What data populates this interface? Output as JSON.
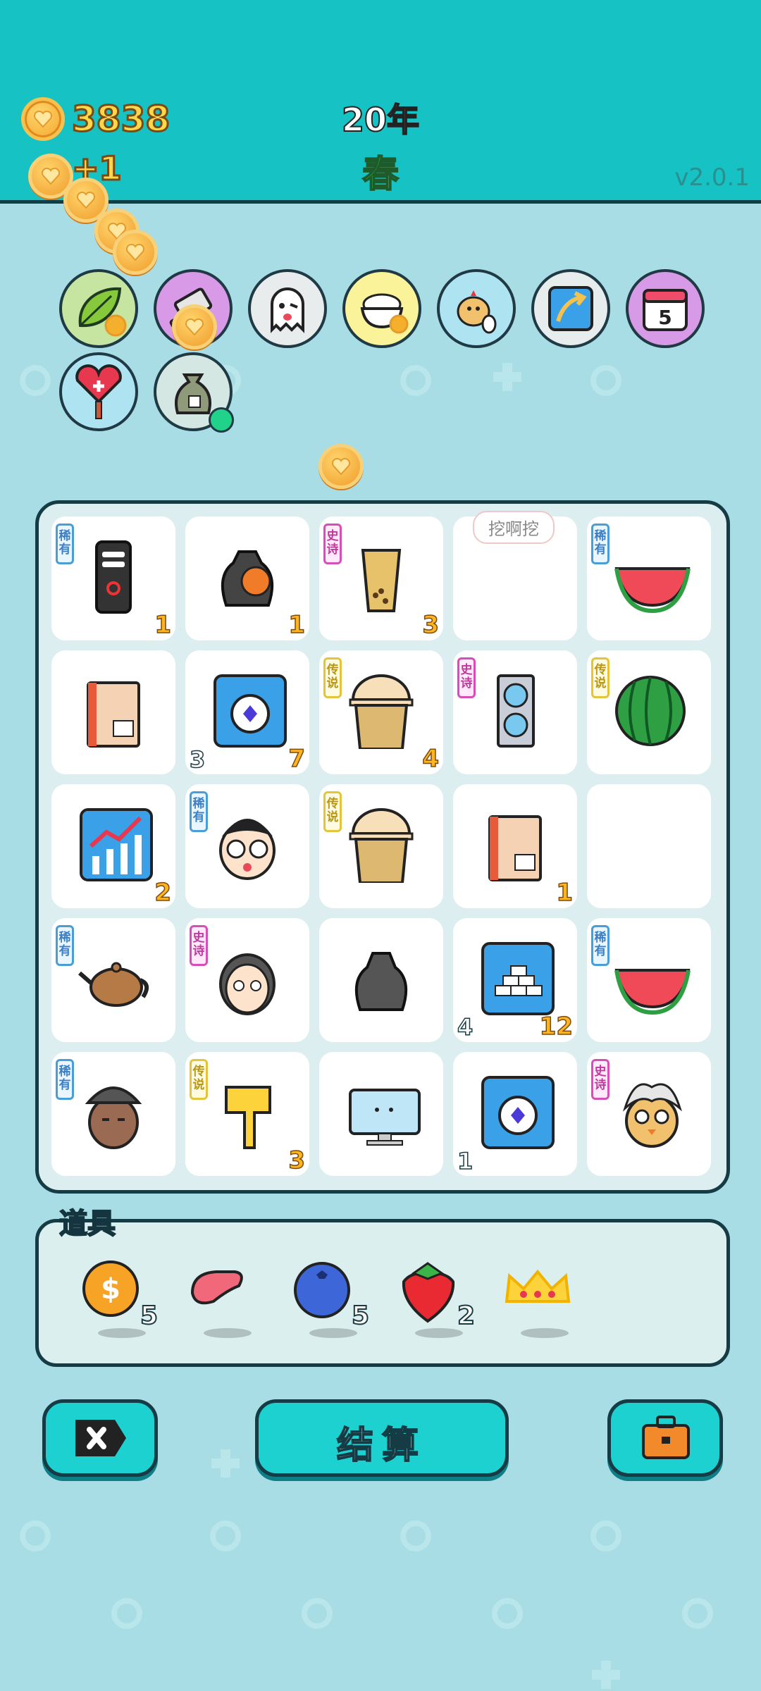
{
  "hud": {
    "coins": "3838",
    "coin_gain": "+1",
    "year": "20年",
    "season": "春",
    "version": "v2.0.1"
  },
  "relics": [
    {
      "name": "leaf-relic-icon",
      "bg": "#c6e5a0"
    },
    {
      "name": "cleaver-relic-icon",
      "bg": "#d899e6"
    },
    {
      "name": "ghost-relic-icon",
      "bg": "#e8ecec"
    },
    {
      "name": "rice-bowl-relic-icon",
      "bg": "#fbf39a"
    },
    {
      "name": "chick-relic-icon",
      "bg": "#aee3f2"
    },
    {
      "name": "blue-arrow-relic-icon",
      "bg": "#e7ecec"
    },
    {
      "name": "calendar-relic-icon",
      "bg": "#d79ae6"
    },
    {
      "name": "heart-potion-relic-icon",
      "bg": "#aee3f2"
    },
    {
      "name": "money-bag-relic-icon",
      "bg": "#d4e7e3"
    }
  ],
  "calendar_day": "5",
  "board": {
    "dig_bubble": "挖啊挖",
    "tags": {
      "rare": "稀有",
      "epic": "史诗",
      "legend": "传说"
    },
    "cells": [
      {
        "item": "phone-icon",
        "tag": "rare",
        "br": "1",
        "bl": ""
      },
      {
        "item": "trash-bag-basketball-icon",
        "tag": "",
        "br": "1",
        "bl": ""
      },
      {
        "item": "bubble-tea-icon",
        "tag": "epic",
        "br": "3",
        "bl": ""
      },
      {
        "item": "empty",
        "tag": "",
        "br": "",
        "bl": ""
      },
      {
        "item": "watermelon-slice-icon",
        "tag": "rare",
        "br": "",
        "bl": ""
      },
      {
        "item": "cardboard-box-icon",
        "tag": "",
        "br": "",
        "bl": ""
      },
      {
        "item": "stopwatch-card-icon",
        "tag": "",
        "br": "7",
        "bl": "3"
      },
      {
        "item": "milk-tea-cup-icon",
        "tag": "legend",
        "br": "4",
        "bl": ""
      },
      {
        "item": "graphics-card-icon",
        "tag": "epic",
        "br": "",
        "bl": ""
      },
      {
        "item": "whole-watermelon-icon",
        "tag": "legend",
        "br": "",
        "bl": ""
      },
      {
        "item": "growth-chart-icon",
        "tag": "",
        "br": "2",
        "bl": ""
      },
      {
        "item": "glasses-boy-face-icon",
        "tag": "rare",
        "br": "",
        "bl": ""
      },
      {
        "item": "milk-tea-cup-icon",
        "tag": "legend",
        "br": "",
        "bl": ""
      },
      {
        "item": "cardboard-box-icon",
        "tag": "",
        "br": "1",
        "bl": ""
      },
      {
        "item": "empty",
        "tag": "",
        "br": "",
        "bl": ""
      },
      {
        "item": "teapot-icon",
        "tag": "rare",
        "br": "",
        "bl": ""
      },
      {
        "item": "long-hair-face-icon",
        "tag": "epic",
        "br": "",
        "bl": ""
      },
      {
        "item": "trash-bag-icon",
        "tag": "",
        "br": "",
        "bl": ""
      },
      {
        "item": "gold-bars-card-icon",
        "tag": "",
        "br": "12",
        "bl": "4"
      },
      {
        "item": "watermelon-slice-icon",
        "tag": "rare",
        "br": "",
        "bl": ""
      },
      {
        "item": "bucket-hat-face-icon",
        "tag": "rare",
        "br": "",
        "bl": ""
      },
      {
        "item": "pointing-hand-icon",
        "tag": "legend",
        "br": "3",
        "bl": ""
      },
      {
        "item": "computer-monitor-icon",
        "tag": "",
        "br": "",
        "bl": ""
      },
      {
        "item": "stopwatch-card-icon",
        "tag": "",
        "br": "",
        "bl": "1"
      },
      {
        "item": "grandpa-chick-icon",
        "tag": "epic",
        "br": "",
        "bl": ""
      }
    ]
  },
  "props_panel": {
    "title": "道具",
    "items": [
      {
        "name": "dollar-coin-icon",
        "count": "5"
      },
      {
        "name": "liver-icon",
        "count": ""
      },
      {
        "name": "blueberry-icon",
        "count": "5"
      },
      {
        "name": "strawberry-icon",
        "count": "2"
      },
      {
        "name": "crown-icon",
        "count": ""
      }
    ]
  },
  "buttons": {
    "close": "close-button",
    "settle": "结算",
    "bag": "briefcase-button"
  },
  "colors": {
    "topbar": "#16c2c4",
    "background": "#a8dde5",
    "coin": "#ffd84a",
    "season": "#2fd657",
    "button": "#1ed1d1"
  }
}
